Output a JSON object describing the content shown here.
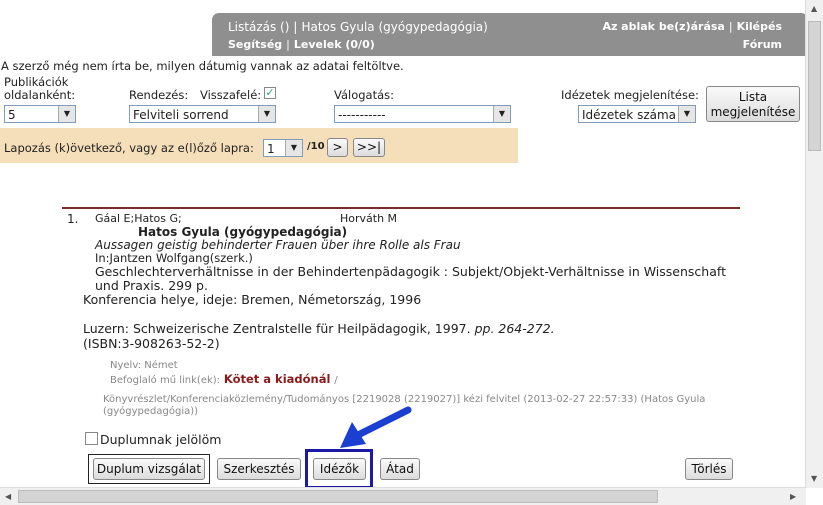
{
  "header": {
    "listing": "Listázás ()",
    "user": "Hatos Gyula (gyógypedagógia)",
    "help": "Segítség",
    "mail": "Levelek (0/0)",
    "close_window": "Az ablak be(z)árása",
    "logout": "Kilépés",
    "forum": "Fórum"
  },
  "notice": "A szerző még nem írta be, milyen dátumig vannak az adatai feltöltve.",
  "controls": {
    "per_page_label_1": "Publikációk",
    "per_page_label_2": "oldalanként:",
    "per_page_value": "5",
    "sort_label": "Rendezés:",
    "reverse_label": "Visszafelé:",
    "sort_value": "Felviteli sorrend",
    "filter_label": "Válogatás:",
    "filter_value": "-----------",
    "citations_label": "Idézetek megjelenítése:",
    "citations_value": "Idézetek száma",
    "list_button": "Lista megjelenítése"
  },
  "paging": {
    "text": "Lapozás (k)övetkező, vagy az e(l)őző lapra:",
    "page_value": "1",
    "total": "/10",
    "next": ">",
    "last": ">>|"
  },
  "record": {
    "number": "1.",
    "authors": "Gáal E;Hatos G;",
    "author2": "Horváth M",
    "owner": "Hatos Gyula (gyógypedagógia)",
    "title": "Aussagen geistig behinderter Frauen über ihre Rolle als Frau",
    "editor": "In:Jantzen Wolfgang(szerk.)",
    "book_1": "Geschlechterverhältnisse in der Behindertenpädagogik : Subjekt/Objekt-Verhältnisse in Wissenschaft",
    "book_2": "und Praxis. 299 p.",
    "conference": "Konferencia helye, ideje: Bremen, Németország, 1996",
    "publisher": "Luzern: Schweizerische Zentralstelle für Heilpädagogik, 1997.",
    "pages": "pp. 264-272.",
    "isbn": "(ISBN:3-908263-52-2)",
    "language": "Nyelv: Német",
    "link_label": "Befoglaló mű link(ek):",
    "link_value": "Kötet a kiadónál",
    "link_sep": "/",
    "meta_1": "Könyvrészlet/Konferenciaközlemény/Tudományos [2219028 (2219027)] kézi felvitel (2013-02-27 22:57:33) (Hatos Gyula",
    "meta_2": "(gyógypedagógia))",
    "duplicate_check_label": "Duplumnak jelölöm"
  },
  "actions": {
    "duplicate_check": "Duplum vizsgálat",
    "edit": "Szerkesztés",
    "citations": "Idézők",
    "transfer": "Átad",
    "delete": "Törlés"
  },
  "colors": {
    "header_bg": "#8f8f8f",
    "paging_bg": "#f5deba",
    "rule": "#7a2b2b",
    "highlight": "#1a1aa6",
    "link": "#8b1a1a"
  }
}
